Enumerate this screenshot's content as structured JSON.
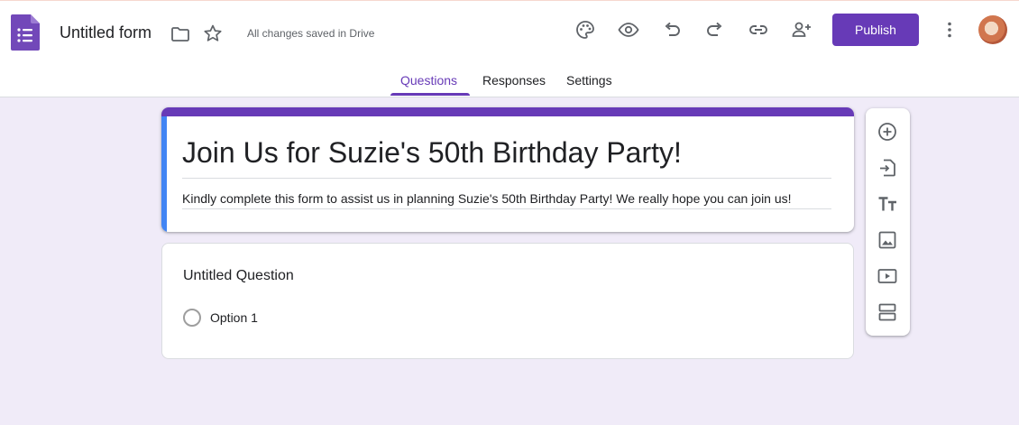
{
  "app": {
    "doc_title": "Untitled form",
    "save_status": "All changes saved in Drive",
    "publish_label": "Publish",
    "brand_color": "#673ab7",
    "header_icons": [
      "palette-icon",
      "preview-eye-icon",
      "undo-icon",
      "redo-icon",
      "link-icon",
      "add-collaborator-icon"
    ]
  },
  "tabs": [
    {
      "label": "Questions",
      "active": true
    },
    {
      "label": "Responses",
      "active": false
    },
    {
      "label": "Settings",
      "active": false
    }
  ],
  "form": {
    "title": "Join Us for Suzie's 50th Birthday Party!",
    "description": "Kindly complete this form to assist us in planning Suzie's 50th Birthday Party! We really hope you can join us!",
    "accent_color": "#4285f4"
  },
  "question": {
    "title": "Untitled Question",
    "options": [
      "Option 1"
    ]
  },
  "side_toolbar": [
    "add-question-icon",
    "import-questions-icon",
    "add-title-icon",
    "add-image-icon",
    "add-video-icon",
    "add-section-icon"
  ]
}
